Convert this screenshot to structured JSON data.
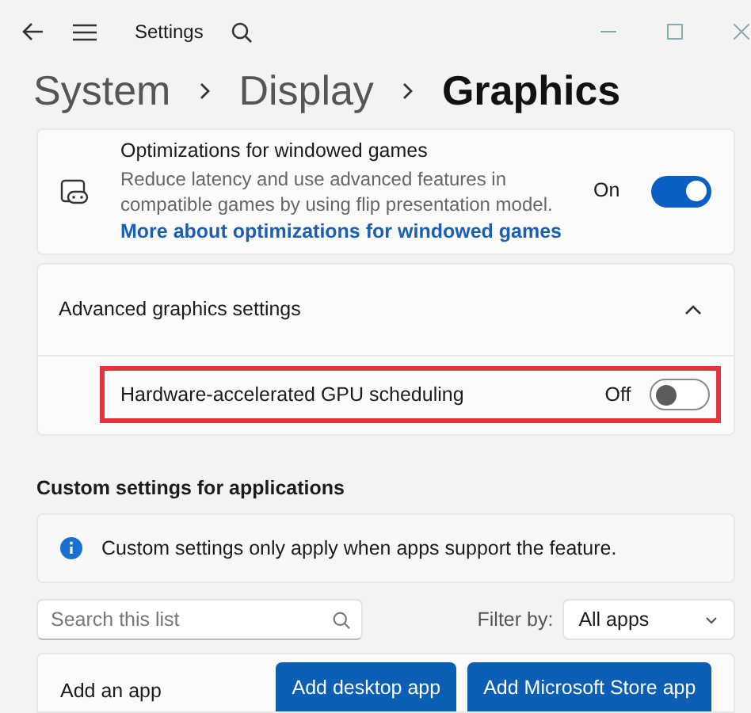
{
  "window": {
    "title": "Settings"
  },
  "breadcrumb": [
    {
      "label": "System",
      "current": false
    },
    {
      "label": "Display",
      "current": false
    },
    {
      "label": "Graphics",
      "current": true
    }
  ],
  "windowed_games": {
    "title": "Optimizations for windowed games",
    "description": "Reduce latency and use advanced features in compatible games by using flip presentation model.",
    "link": "More about optimizations for windowed games",
    "state_label": "On",
    "on": true
  },
  "advanced": {
    "title": "Advanced graphics settings",
    "expanded": true,
    "items": [
      {
        "label": "Hardware-accelerated GPU scheduling",
        "state_label": "Off",
        "on": false,
        "highlighted": true
      }
    ]
  },
  "custom": {
    "heading": "Custom settings for applications",
    "info": "Custom settings only apply when apps support the feature.",
    "search": {
      "placeholder": "Search this list"
    },
    "filter_label": "Filter by:",
    "filter_value": "All apps",
    "add_label": "Add an app",
    "buttons": [
      "Add desktop app",
      "Add Microsoft Store app"
    ]
  }
}
